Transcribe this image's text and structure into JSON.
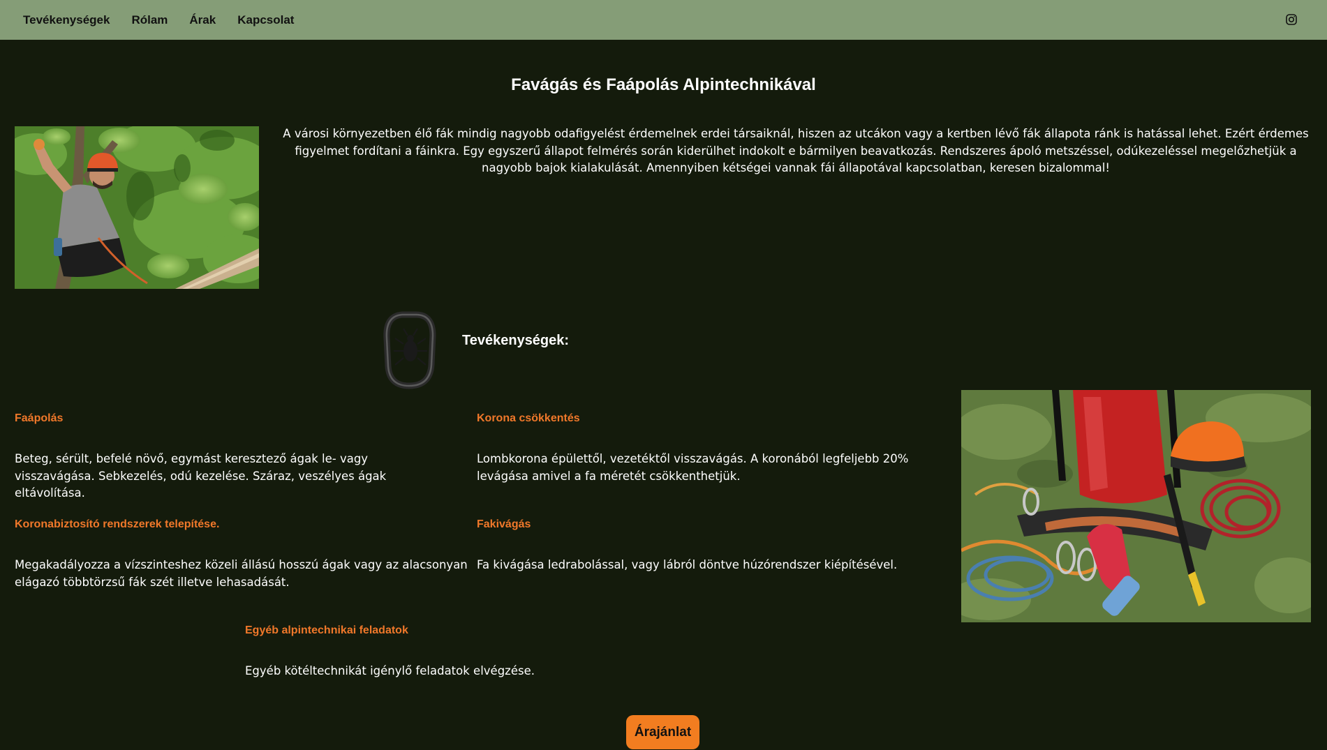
{
  "nav": {
    "items": [
      {
        "label": "Tevékenységek"
      },
      {
        "label": "Rólam"
      },
      {
        "label": "Árak"
      },
      {
        "label": "Kapcsolat"
      }
    ],
    "social_icon": "instagram-icon",
    "background": "#859d77"
  },
  "main": {
    "title": "Favágás és Faápolás Alpintechnikával",
    "intro": "A városi környezetben élő fák mindig nagyobb odafigyelést érdemelnek erdei társaiknál, hiszen az utcákon vagy a kertben lévő fák állapota ránk is hatással lehet. Ezért érdemes figyelmet fordítani a fáinkra. Egy egyszerű állapot felmérés során kiderülhet indokolt e bármilyen beavatkozás. Rendszeres ápoló metszéssel, odúkezeléssel megelőzhetjük a nagyobb bajok kialakulását. Amennyiben kétségei vannak fái állapotával kapcsolatban, keresen bizalommal!",
    "hero_image": "arborist-in-tree-photo",
    "gear_image": "climbing-gear-photo"
  },
  "services": {
    "heading": "Tevékenységek:",
    "icon": "carabiner-icon",
    "items": [
      {
        "title": "Faápolás",
        "desc": "Beteg, sérült, befelé növő, egymást keresztező ágak le- vagy visszavágása. Sebkezelés, odú kezelése. Száraz, veszélyes ágak eltávolítása."
      },
      {
        "title": "Korona csökkentés",
        "desc": "Lombkorona épülettől, vezetéktől visszavágás. A koronából legfeljebb 20% levágása amivel a fa méretét csökkenthetjük."
      },
      {
        "title": "Koronabiztosító rendszerek telepítése.",
        "desc": "Megakadályozza a vízszinteshez közeli állású hosszú ágak vagy az alacsonyan elágazó többtörzsű fák szét illetve lehasadását."
      },
      {
        "title": "Fakivágás",
        "desc": "Fa kivágása ledrabolással, vagy lábról döntve húzórendszer kiépítésével."
      },
      {
        "title": "Egyéb alpintechnikai feladatok",
        "desc": "Egyéb kötéltechnikát igénylő feladatok elvégzése."
      }
    ]
  },
  "cta": {
    "label": "Árajánlat",
    "color": "#f27d20"
  },
  "colors": {
    "background": "#141b0c",
    "accent": "#f0782a",
    "text": "#ffffff"
  }
}
